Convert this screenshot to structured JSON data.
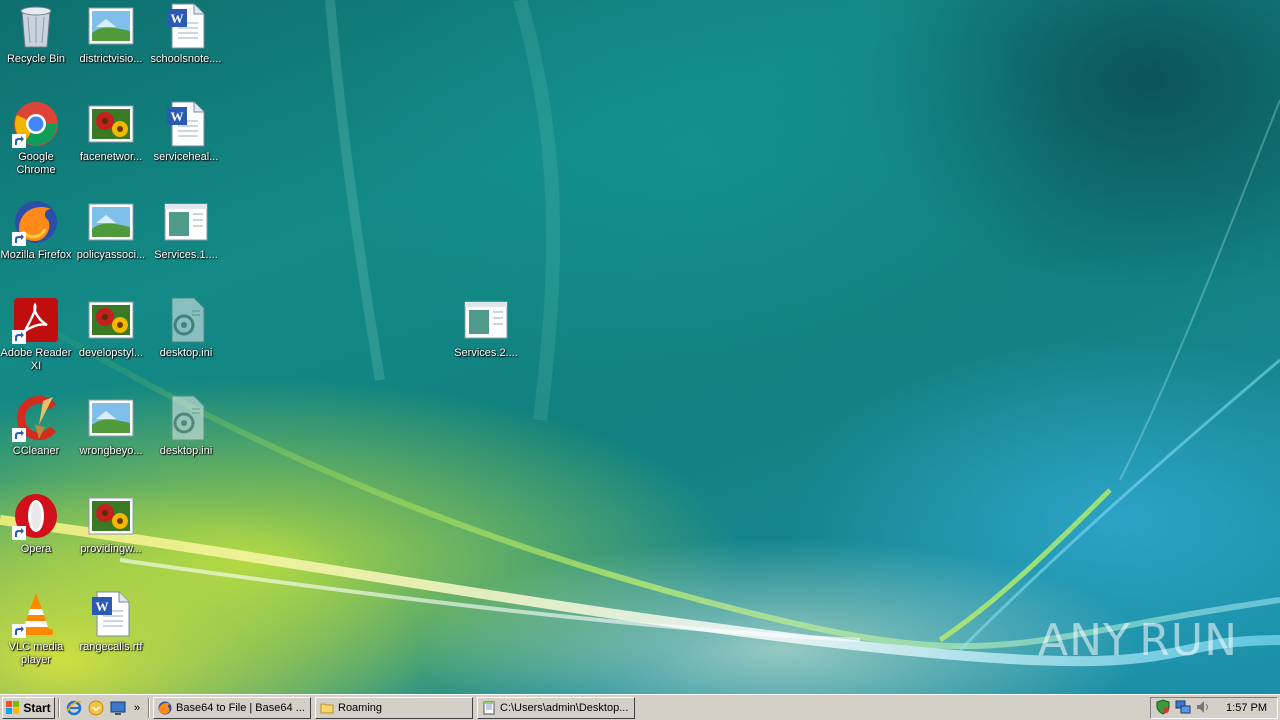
{
  "desktop": {
    "icons": [
      {
        "label": "Recycle Bin",
        "icon": "recycle-bin-icon"
      },
      {
        "label": "districtvisio...",
        "icon": "image-file-icon"
      },
      {
        "label": "schoolsnote....",
        "icon": "word-document-icon"
      },
      {
        "label": "Google Chrome",
        "icon": "chrome-icon"
      },
      {
        "label": "facenetwor...",
        "icon": "image-file-icon"
      },
      {
        "label": "serviceheal...",
        "icon": "word-document-icon"
      },
      {
        "label": "Mozilla Firefox",
        "icon": "firefox-icon"
      },
      {
        "label": "policyassoci...",
        "icon": "image-file-icon"
      },
      {
        "label": "Services.1....",
        "icon": "program-window-icon"
      },
      {
        "label": "Adobe Reader XI",
        "icon": "adobe-reader-icon"
      },
      {
        "label": "developstyl...",
        "icon": "image-file-icon"
      },
      {
        "label": "desktop.ini",
        "icon": "config-file-icon"
      },
      {
        "label": "Services.2....",
        "icon": "program-window-icon"
      },
      {
        "label": "CCleaner",
        "icon": "ccleaner-icon"
      },
      {
        "label": "wrongbeyo...",
        "icon": "image-file-icon"
      },
      {
        "label": "desktop.ini",
        "icon": "config-file-icon"
      },
      {
        "label": "Opera",
        "icon": "opera-icon"
      },
      {
        "label": "providingw...",
        "icon": "image-file-icon"
      },
      {
        "label": "VLC media player",
        "icon": "vlc-icon"
      },
      {
        "label": "rangecalls.rtf",
        "icon": "word-document-icon"
      }
    ],
    "watermark": {
      "left": "ANY",
      "right": "RUN"
    }
  },
  "taskbar": {
    "start_label": "Start",
    "quick_launch": [
      "ie-icon",
      "outlook-express-icon",
      "show-desktop-icon"
    ],
    "more_label": "»",
    "tasks": [
      {
        "label": "Base64 to File | Base64 ...",
        "icon": "firefox-icon"
      },
      {
        "label": "Roaming",
        "icon": "folder-icon"
      },
      {
        "label": "C:\\Users\\admin\\Desktop...",
        "icon": "notepad-icon"
      }
    ],
    "tray": {
      "icons": [
        "security-shield-icon",
        "network-icon",
        "volume-icon"
      ],
      "clock": "1:57 PM"
    }
  }
}
